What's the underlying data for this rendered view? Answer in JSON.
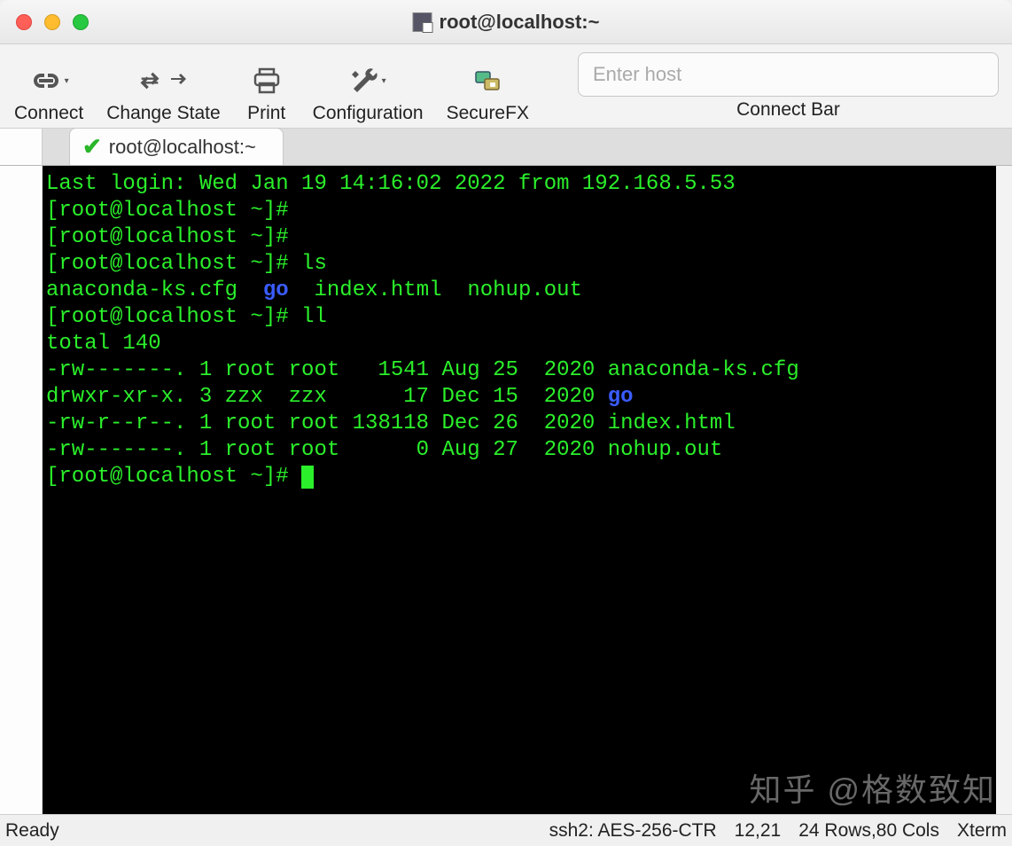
{
  "window": {
    "title": "root@localhost:~"
  },
  "toolbar": {
    "connect_label": "Connect",
    "change_state_label": "Change State",
    "print_label": "Print",
    "configuration_label": "Configuration",
    "securefx_label": "SecureFX",
    "connect_bar_label": "Connect Bar",
    "host_placeholder": "Enter host"
  },
  "tabs": {
    "active_label": "root@localhost:~"
  },
  "terminal": {
    "last_login": "Last login: Wed Jan 19 14:16:02 2022 from 192.168.5.53",
    "prompt": "[root@localhost ~]# ",
    "cmd_ls": "ls",
    "cmd_ll": "ll",
    "ls_files": {
      "f1": "anaconda-ks.cfg",
      "f2": "go",
      "f3": "index.html",
      "f4": "nohup.out"
    },
    "ll_total": "total 140",
    "ll_rows": [
      "-rw-------. 1 root root   1541 Aug 25  2020 anaconda-ks.cfg",
      "drwxr-xr-x. 3 zzx  zzx      17 Dec 15  2020 ",
      "-rw-r--r--. 1 root root 138118 Dec 26  2020 index.html",
      "-rw-------. 1 root root      0 Aug 27  2020 nohup.out"
    ],
    "ll_row2_dir": "go"
  },
  "status": {
    "ready": "Ready",
    "protocol": "ssh2: AES-256-CTR",
    "cursor": "12,21",
    "size": "24 Rows,80 Cols",
    "term": "Xterm"
  },
  "watermark": "知乎 @格数致知"
}
